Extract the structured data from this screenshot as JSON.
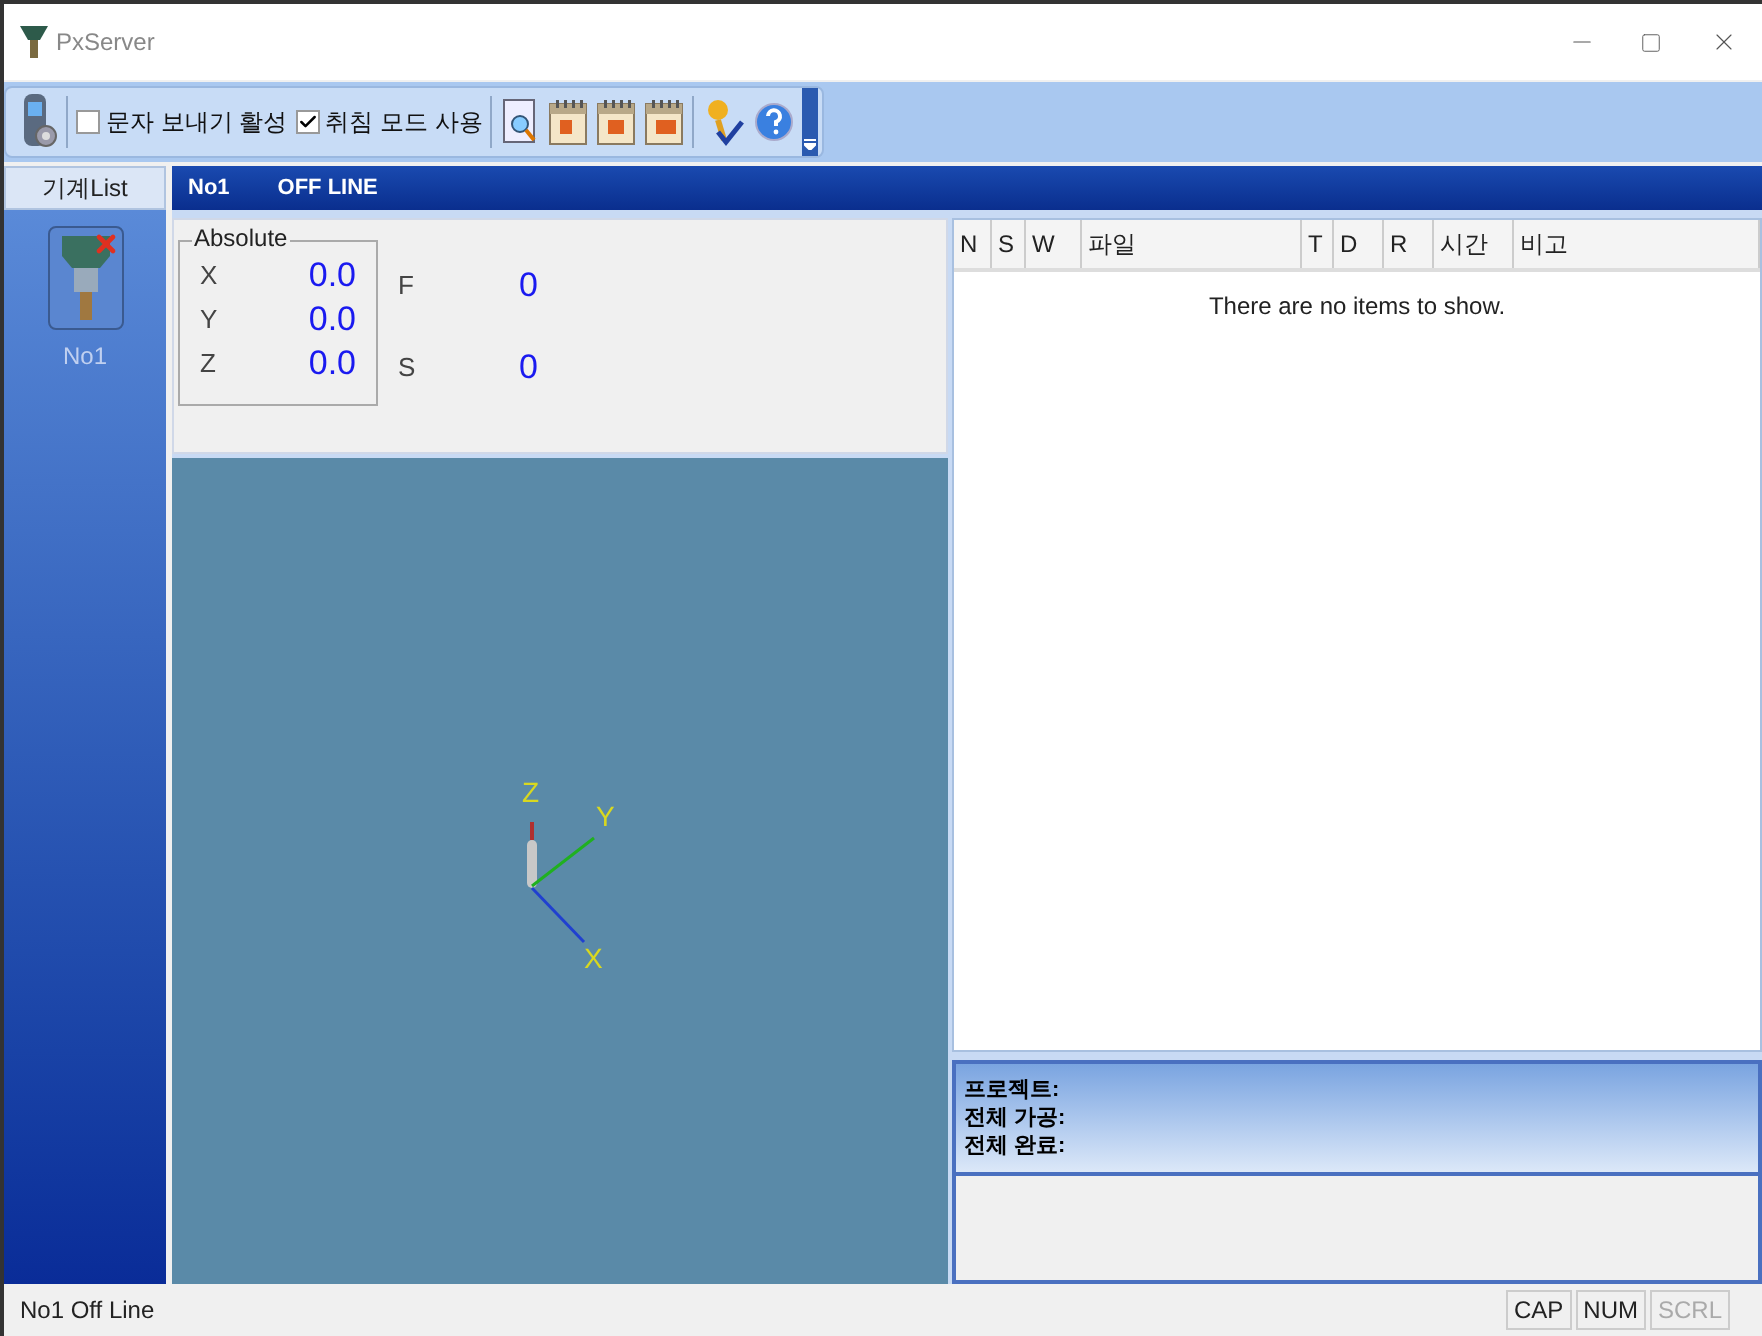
{
  "window": {
    "title": "PxServer"
  },
  "toolbar": {
    "checkboxes": [
      {
        "label": "문자 보내기 활성",
        "checked": false
      },
      {
        "label": "취침 모드 사용",
        "checked": true
      }
    ]
  },
  "sidebar": {
    "header": "기계List",
    "items": [
      {
        "label": "No1",
        "online": false
      }
    ]
  },
  "panel_header": {
    "machine": "No1",
    "status": "OFF LINE"
  },
  "position": {
    "group": "Absolute",
    "axes": [
      {
        "label": "X",
        "value": "0.0"
      },
      {
        "label": "Y",
        "value": "0.0"
      },
      {
        "label": "Z",
        "value": "0.0"
      }
    ],
    "feed": {
      "label": "F",
      "value": "0"
    },
    "spindle": {
      "label": "S",
      "value": "0"
    }
  },
  "view": {
    "axis_labels": [
      "Z",
      "Y",
      "X"
    ]
  },
  "table": {
    "columns": [
      "N",
      "S",
      "W",
      "파일",
      "T",
      "D",
      "R",
      "시간",
      "비고"
    ],
    "empty_message": "There are no items to show."
  },
  "summary": [
    "프로젝트:",
    "전체 가공:",
    "전체 완료:"
  ],
  "status_bar": {
    "message": "No1 Off Line",
    "indicators": [
      {
        "label": "CAP",
        "on": true
      },
      {
        "label": "NUM",
        "on": true
      },
      {
        "label": "SCRL",
        "on": false
      }
    ]
  }
}
